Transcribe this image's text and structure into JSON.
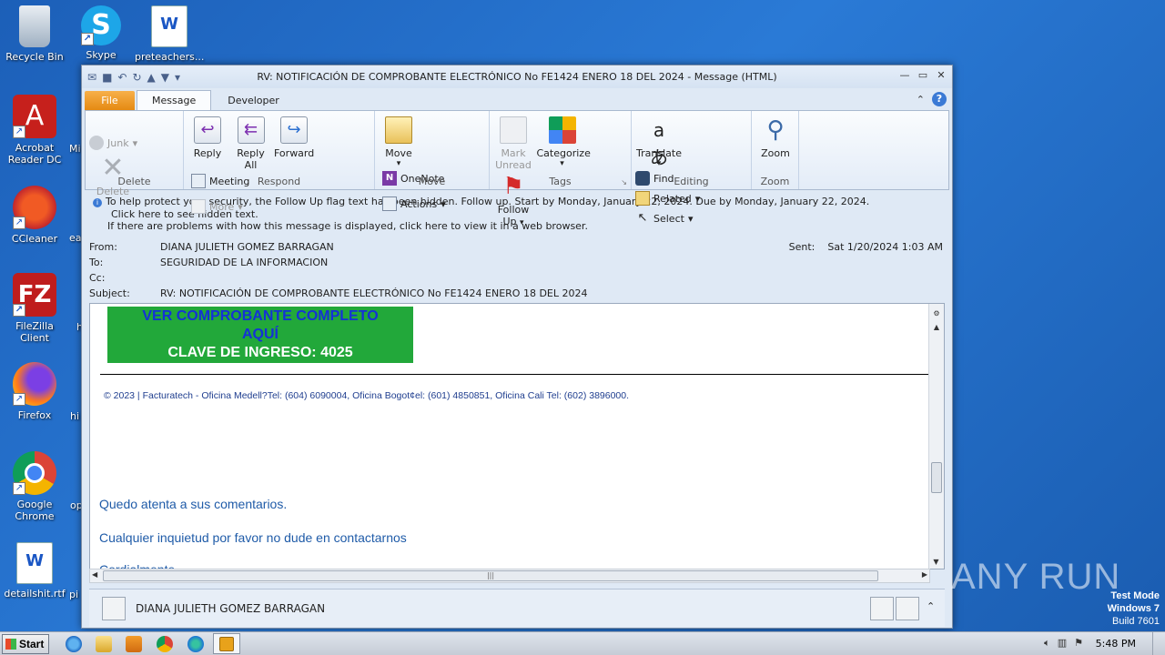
{
  "desktop": {
    "icons": [
      {
        "label": "Recycle Bin"
      },
      {
        "label": "Skype"
      },
      {
        "label": "preteachers..."
      },
      {
        "label": "Acrobat Reader DC"
      },
      {
        "label": "CCleaner"
      },
      {
        "label": "FileZilla Client"
      },
      {
        "label": "Firefox"
      },
      {
        "label": "Google Chrome"
      },
      {
        "label": "detailshit.rtf"
      }
    ],
    "cut_labels": [
      "Mi",
      "ea",
      "h",
      "hi",
      "op",
      "pi"
    ]
  },
  "window": {
    "title": "RV: NOTIFICACIÓN DE COMPROBANTE ELECTRÓNICO No FE1424 ENERO 18 DEL 2024  -  Message (HTML)",
    "tabs": {
      "file": "File",
      "message": "Message",
      "developer": "Developer"
    }
  },
  "ribbon": {
    "delete_group": {
      "label": "Delete",
      "junk": "Junk",
      "delete": "Delete"
    },
    "respond_group": {
      "label": "Respond",
      "reply": "Reply",
      "reply_all_1": "Reply",
      "reply_all_2": "All",
      "forward": "Forward",
      "meeting": "Meeting",
      "more": "More"
    },
    "move_group": {
      "label": "Move",
      "move": "Move",
      "onenote": "OneNote",
      "actions": "Actions"
    },
    "tags_group": {
      "label": "Tags",
      "mark_unread_1": "Mark",
      "mark_unread_2": "Unread",
      "categorize": "Categorize",
      "follow_up_1": "Follow",
      "follow_up_2": "Up"
    },
    "editing_group": {
      "label": "Editing",
      "translate": "Translate",
      "find": "Find",
      "related": "Related",
      "select": "Select"
    },
    "zoom_group": {
      "label": "Zoom",
      "zoom": "Zoom"
    }
  },
  "infobar": {
    "line1": "To help protect your security, the Follow Up flag text has been hidden. Follow up.  Start by Monday, January 22, 2024.  Due by Monday, January 22, 2024.",
    "line2": "Click here to see hidden text.",
    "line3": "If there are problems with how this message is displayed, click here to view it in a web browser."
  },
  "headers": {
    "from_label": "From:",
    "from": "DIANA JULIETH GOMEZ BARRAGAN",
    "to_label": "To:",
    "to": "SEGURIDAD DE LA INFORMACION",
    "cc_label": "Cc:",
    "cc": "",
    "subject_label": "Subject:",
    "subject": "RV: NOTIFICACIÓN DE COMPROBANTE ELECTRÓNICO No FE1424 ENERO 18 DEL 2024",
    "sent_label": "Sent:",
    "sent": "Sat 1/20/2024 1:03 AM"
  },
  "body": {
    "button_line1": "VER COMPROBANTE COMPLETO",
    "button_line2": "AQUÍ",
    "button_line3": "CLAVE DE INGRESO: 4025",
    "footer": "© 2023 | Facturatech - Oficina Medell?Tel: (604) 6090004, Oficina Bogot¢el: (601) 4850851, Oficina Cali Tel: (602) 3896000.",
    "para1": "Quedo atenta a sus comentarios.",
    "para2": "Cualquier inquietud por favor no dude en contactarnos",
    "para3": "Cordialmente"
  },
  "people_pane": {
    "name": "DIANA JULIETH GOMEZ BARRAGAN"
  },
  "taskbar": {
    "start": "Start",
    "time": "5:48 PM"
  },
  "watermark": {
    "text": "ANY RUN",
    "mode": "Test Mode",
    "os": "Windows 7",
    "build": "Build 7601"
  },
  "colors": {
    "accent": "#2a7ad6",
    "file_tab": "#e58a12",
    "button_green": "#22a83a",
    "link_blue": "#1f5ba8"
  }
}
